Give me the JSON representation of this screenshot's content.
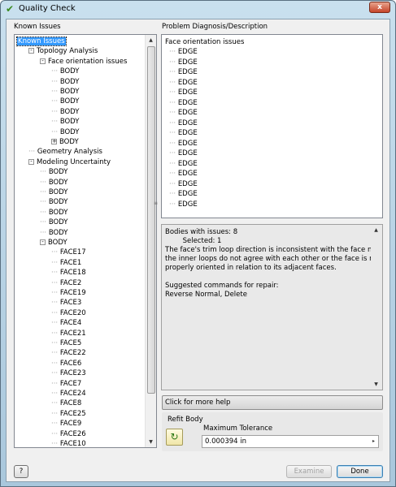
{
  "window": {
    "title": "Quality Check",
    "close_glyph": "x"
  },
  "known_issues": {
    "label": "Known Issues",
    "tree": [
      {
        "indent": 0,
        "text": "Known Issues",
        "selected": true,
        "expander": ""
      },
      {
        "indent": 1,
        "text": "Topology Analysis",
        "expander": "-"
      },
      {
        "indent": 2,
        "text": "Face orientation issues",
        "expander": "-"
      },
      {
        "indent": 3,
        "text": "BODY",
        "expander": ""
      },
      {
        "indent": 3,
        "text": "BODY",
        "expander": ""
      },
      {
        "indent": 3,
        "text": "BODY",
        "expander": ""
      },
      {
        "indent": 3,
        "text": "BODY",
        "expander": ""
      },
      {
        "indent": 3,
        "text": "BODY",
        "expander": ""
      },
      {
        "indent": 3,
        "text": "BODY",
        "expander": ""
      },
      {
        "indent": 3,
        "text": "BODY",
        "expander": ""
      },
      {
        "indent": 3,
        "text": "BODY",
        "expander": "+"
      },
      {
        "indent": 1,
        "text": "Geometry Analysis",
        "expander": ""
      },
      {
        "indent": 1,
        "text": "Modeling Uncertainty",
        "expander": "-"
      },
      {
        "indent": 2,
        "text": "BODY",
        "expander": ""
      },
      {
        "indent": 2,
        "text": "BODY",
        "expander": ""
      },
      {
        "indent": 2,
        "text": "BODY",
        "expander": ""
      },
      {
        "indent": 2,
        "text": "BODY",
        "expander": ""
      },
      {
        "indent": 2,
        "text": "BODY",
        "expander": ""
      },
      {
        "indent": 2,
        "text": "BODY",
        "expander": ""
      },
      {
        "indent": 2,
        "text": "BODY",
        "expander": ""
      },
      {
        "indent": 2,
        "text": "BODY",
        "expander": "-"
      },
      {
        "indent": 3,
        "text": "FACE17",
        "expander": ""
      },
      {
        "indent": 3,
        "text": "FACE1",
        "expander": ""
      },
      {
        "indent": 3,
        "text": "FACE18",
        "expander": ""
      },
      {
        "indent": 3,
        "text": "FACE2",
        "expander": ""
      },
      {
        "indent": 3,
        "text": "FACE19",
        "expander": ""
      },
      {
        "indent": 3,
        "text": "FACE3",
        "expander": ""
      },
      {
        "indent": 3,
        "text": "FACE20",
        "expander": ""
      },
      {
        "indent": 3,
        "text": "FACE4",
        "expander": ""
      },
      {
        "indent": 3,
        "text": "FACE21",
        "expander": ""
      },
      {
        "indent": 3,
        "text": "FACE5",
        "expander": ""
      },
      {
        "indent": 3,
        "text": "FACE22",
        "expander": ""
      },
      {
        "indent": 3,
        "text": "FACE6",
        "expander": ""
      },
      {
        "indent": 3,
        "text": "FACE23",
        "expander": ""
      },
      {
        "indent": 3,
        "text": "FACE7",
        "expander": ""
      },
      {
        "indent": 3,
        "text": "FACE24",
        "expander": ""
      },
      {
        "indent": 3,
        "text": "FACE8",
        "expander": ""
      },
      {
        "indent": 3,
        "text": "FACE25",
        "expander": ""
      },
      {
        "indent": 3,
        "text": "FACE9",
        "expander": ""
      },
      {
        "indent": 3,
        "text": "FACE26",
        "expander": ""
      },
      {
        "indent": 3,
        "text": "FACE10",
        "expander": ""
      }
    ]
  },
  "diagnosis": {
    "label": "Problem Diagnosis/Description",
    "header": "Face orientation issues",
    "edges": [
      "EDGE",
      "EDGE",
      "EDGE",
      "EDGE",
      "EDGE",
      "EDGE",
      "EDGE",
      "EDGE",
      "EDGE",
      "EDGE",
      "EDGE",
      "EDGE",
      "EDGE",
      "EDGE",
      "EDGE",
      "EDGE"
    ]
  },
  "description": {
    "lines": [
      "Bodies with issues: 8",
      "        Selected: 1",
      "The face's trim loop direction is inconsistent with the face normal or",
      "the inner loops do not agree with each other or the face is not",
      "properly oriented in relation to its adjacent faces.",
      "",
      "Suggested commands for repair:",
      "Reverse Normal, Delete"
    ]
  },
  "help_bar": {
    "text": "Click for more help"
  },
  "refit": {
    "label": "Refit Body",
    "tolerance_label": "Maximum Tolerance",
    "tolerance_value": "0.000394 in"
  },
  "buttons": {
    "help": "?",
    "examine": "Examine",
    "done": "Done"
  },
  "colors": {
    "selection": "#3399ff",
    "title_check": "#3a8a1f"
  }
}
